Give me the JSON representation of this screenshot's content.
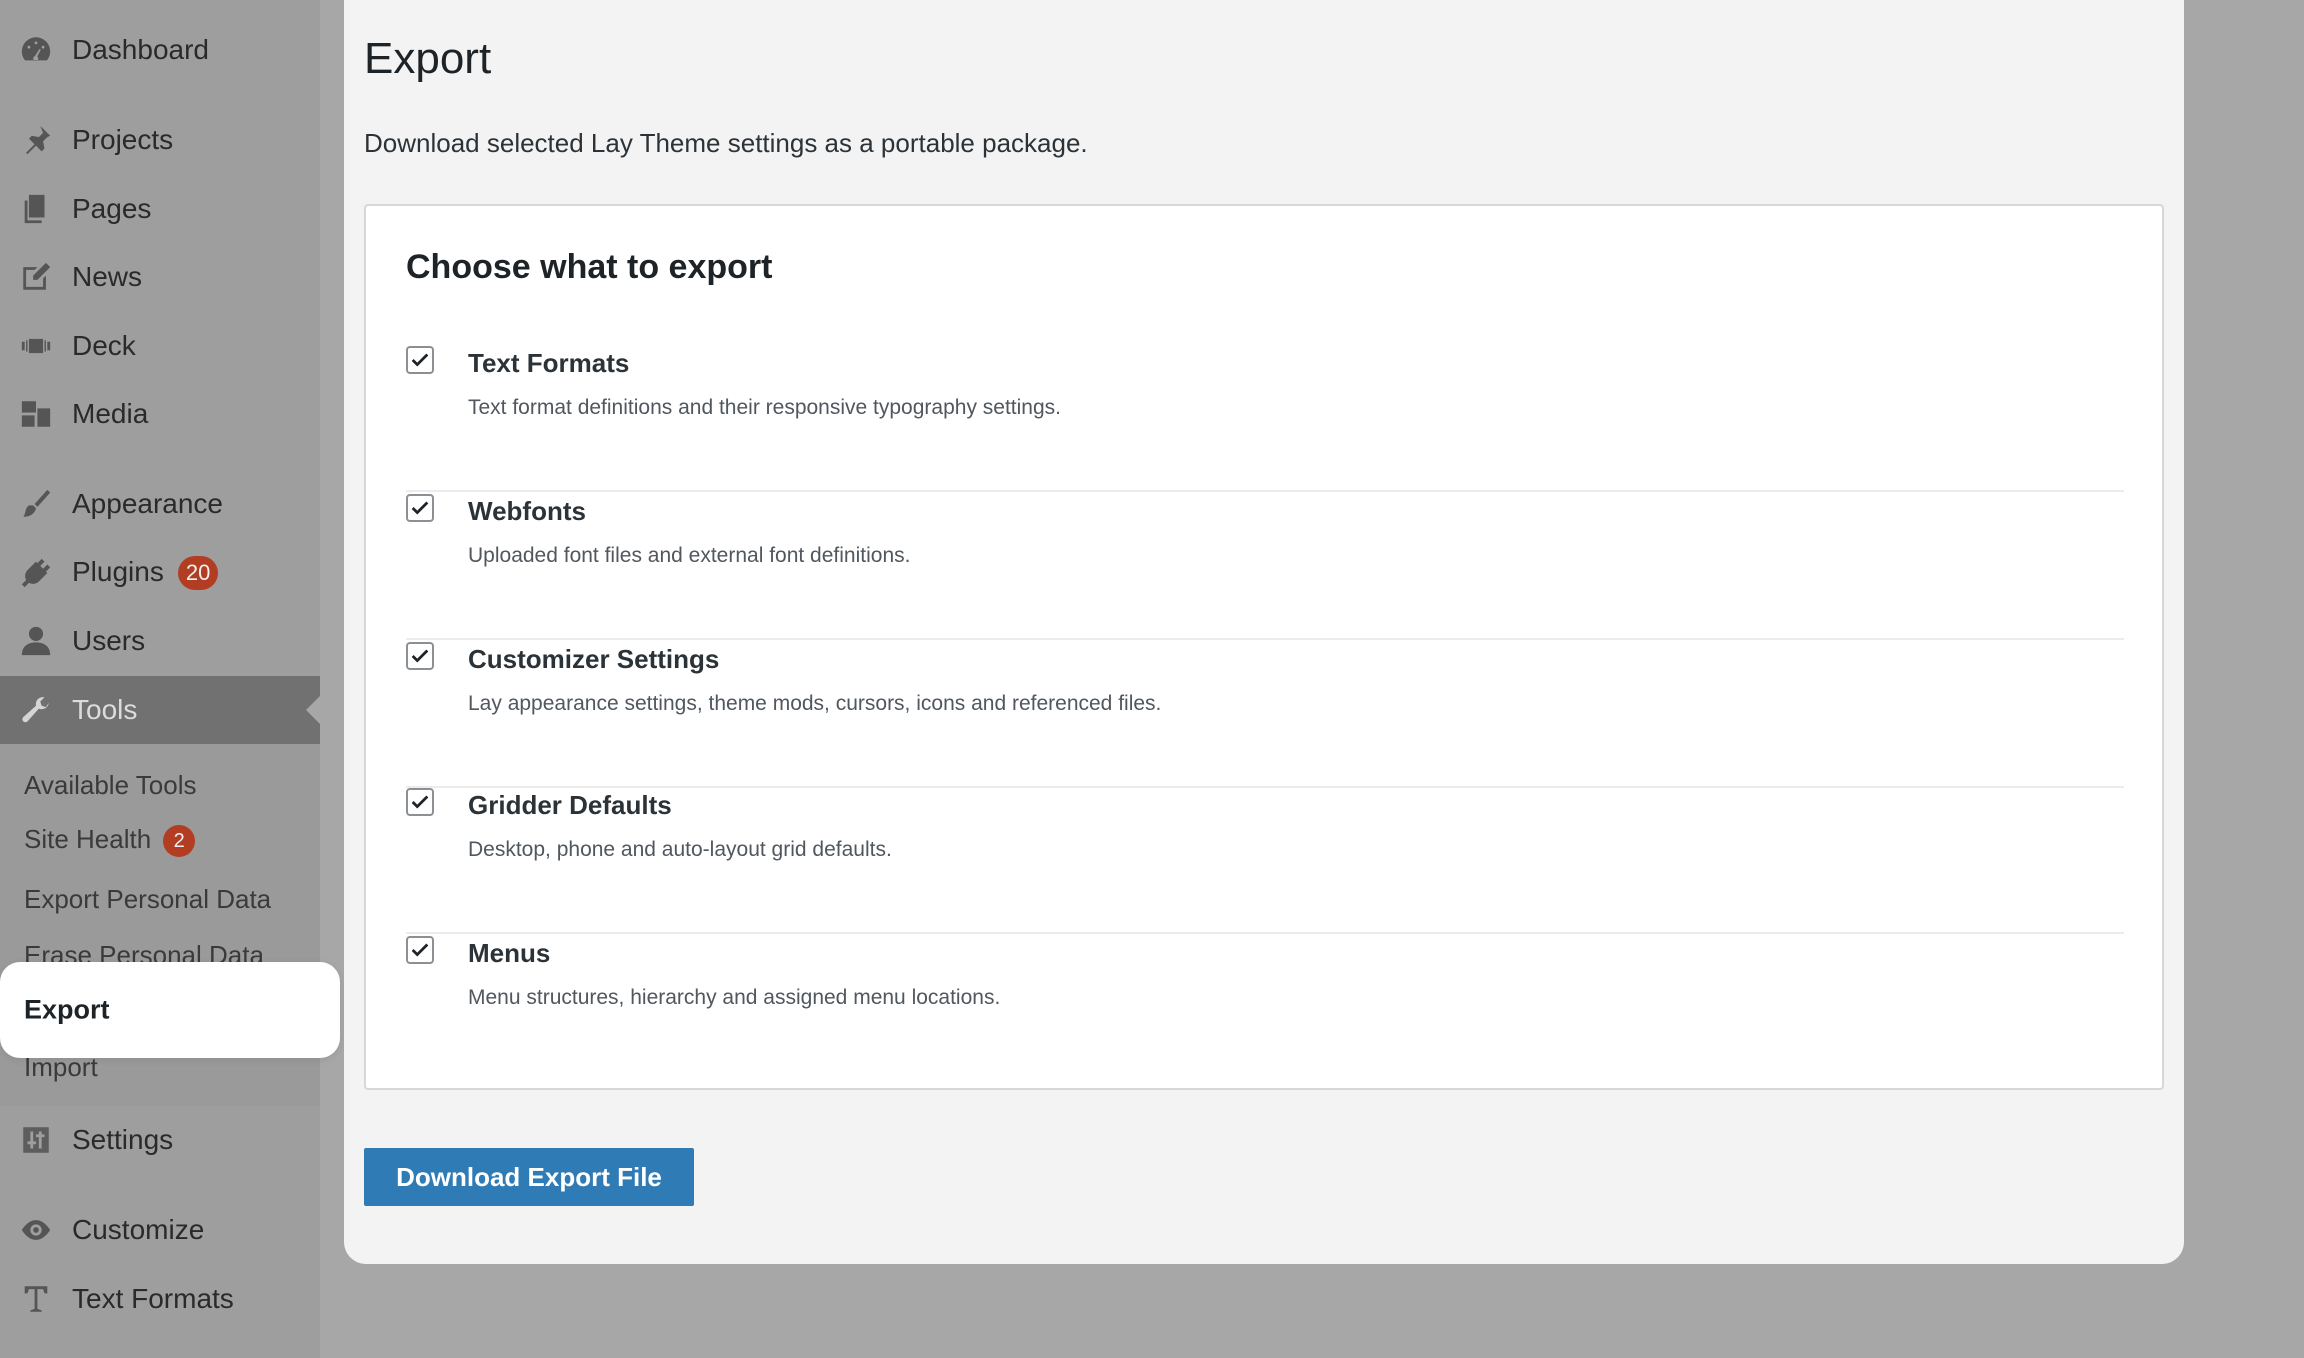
{
  "sidebar": {
    "items": [
      {
        "label": "Dashboard",
        "icon": "dashboard-icon"
      },
      {
        "label": "Projects",
        "icon": "pin-icon"
      },
      {
        "label": "Pages",
        "icon": "pages-icon"
      },
      {
        "label": "News",
        "icon": "edit-icon"
      },
      {
        "label": "Deck",
        "icon": "deck-icon"
      },
      {
        "label": "Media",
        "icon": "media-icon"
      },
      {
        "label": "Appearance",
        "icon": "brush-icon"
      },
      {
        "label": "Plugins",
        "icon": "plug-icon",
        "badge": "20"
      },
      {
        "label": "Users",
        "icon": "user-icon"
      },
      {
        "label": "Tools",
        "icon": "wrench-icon",
        "active": true
      },
      {
        "label": "Settings",
        "icon": "settings-icon"
      },
      {
        "label": "Customize",
        "icon": "eye-icon"
      },
      {
        "label": "Text Formats",
        "icon": "text-icon"
      }
    ],
    "tools_submenu": [
      {
        "label": "Available Tools"
      },
      {
        "label": "Site Health",
        "badge": "2"
      },
      {
        "label": "Export Personal Data"
      },
      {
        "label": "Erase Personal Data"
      },
      {
        "label": "Export",
        "current": true
      },
      {
        "label": "Import"
      }
    ]
  },
  "main": {
    "title": "Export",
    "description": "Download selected Lay Theme settings as a portable package.",
    "card_title": "Choose what to export",
    "options": [
      {
        "title": "Text Formats",
        "description": "Text format definitions and their responsive typography settings.",
        "checked": true
      },
      {
        "title": "Webfonts",
        "description": "Uploaded font files and external font definitions.",
        "checked": true
      },
      {
        "title": "Customizer Settings",
        "description": "Lay appearance settings, theme mods, cursors, icons and referenced files.",
        "checked": true
      },
      {
        "title": "Gridder Defaults",
        "description": "Desktop, phone and auto-layout grid defaults.",
        "checked": true
      },
      {
        "title": "Menus",
        "description": "Menu structures, hierarchy and assigned menu locations.",
        "checked": true
      }
    ],
    "download_label": "Download Export File"
  },
  "colors": {
    "accent_button": "#2f7bb6",
    "badge": "#b23d22",
    "sidebar_bg": "#9e9e9e",
    "active_menu_bg": "#717171"
  }
}
